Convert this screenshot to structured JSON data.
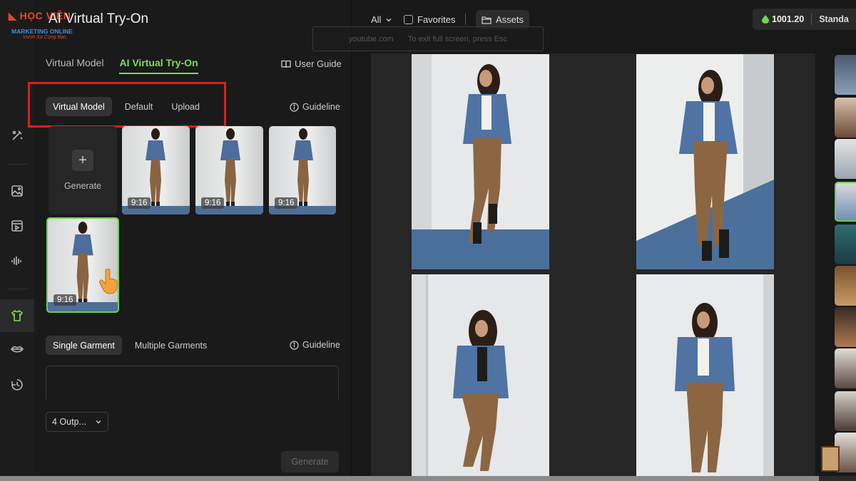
{
  "app": {
    "logo_text": "HỌC VIỆN",
    "logo_sub": "MARKETING ONLINE",
    "logo_tagline": "Vươn Xa Cùng Bạn",
    "title": "AI Virtual Try-On"
  },
  "sidebar": {
    "items": [
      {
        "icon": "magic-wand-icon",
        "active": false
      },
      {
        "icon": "image-icon",
        "active": false
      },
      {
        "icon": "video-icon",
        "active": false
      },
      {
        "icon": "audio-wave-icon",
        "active": false
      },
      {
        "icon": "shirt-icon",
        "active": true
      },
      {
        "icon": "lips-icon",
        "active": false
      },
      {
        "icon": "history-icon",
        "active": false
      }
    ]
  },
  "panel": {
    "tabs": [
      {
        "label": "Virtual Model",
        "active": false
      },
      {
        "label": "AI Virtual Try-On",
        "active": true
      }
    ],
    "user_guide": "User Guide",
    "model_source_tabs": [
      {
        "label": "Virtual Model",
        "active": true
      },
      {
        "label": "Default",
        "active": false
      },
      {
        "label": "Upload",
        "active": false
      }
    ],
    "guideline": "Guideline",
    "generate_card": {
      "label": "Generate"
    },
    "model_thumbs": [
      {
        "ratio": "9:16",
        "selected": false
      },
      {
        "ratio": "9:16",
        "selected": false
      },
      {
        "ratio": "9:16",
        "selected": false
      },
      {
        "ratio": "9:16",
        "selected": true
      }
    ],
    "garment_tabs": [
      {
        "label": "Single Garment",
        "active": true
      },
      {
        "label": "Multiple Garments",
        "active": false
      }
    ],
    "garment_guideline": "Guideline",
    "outputs_select": "4 Outp...",
    "generate_button": "Generate"
  },
  "topbar": {
    "filter_all": "All",
    "favorites": "Favorites",
    "assets": "Assets",
    "credits": "1001.20",
    "plan": "Standa"
  },
  "overlay": {
    "domain": "youtube.com",
    "hint": "To exit full screen, press",
    "key": "Esc"
  },
  "colors": {
    "accent": "#7ddc5a",
    "highlight_box": "#e01e1e",
    "background": "#181818"
  }
}
